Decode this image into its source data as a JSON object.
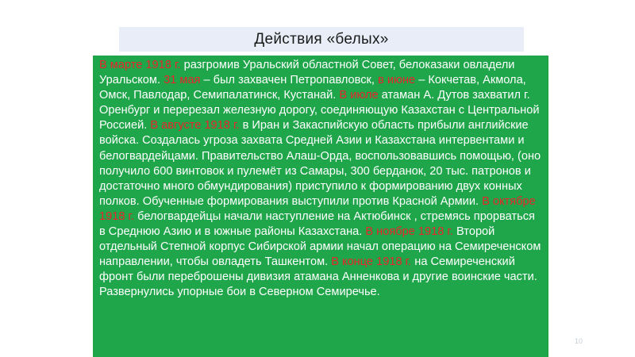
{
  "slide": {
    "title": "Действия «белых»",
    "page_number": "10",
    "colors": {
      "title_bar": "#e8edf7",
      "body_background": "#1fa64a",
      "body_text": "#ffffff",
      "highlight_text": "#e8262b"
    },
    "paragraph": [
      {
        "text": "В марте 1918 г.",
        "highlight": true
      },
      {
        "text": " разгромив Уральский областной Совет, белоказаки овладели Уральском. ",
        "highlight": false
      },
      {
        "text": "31 мая",
        "highlight": true
      },
      {
        "text": " – был захвачен Петропавловск, ",
        "highlight": false
      },
      {
        "text": "в июне",
        "highlight": true
      },
      {
        "text": " – Кокчетав, Акмола, Омск, Павлодар, Семипалатинск, Кустанай.  ",
        "highlight": false
      },
      {
        "text": "В июле",
        "highlight": true
      },
      {
        "text": " атаман А. Дутов захватил г. Оренбург и перерезал железную дорогу, соединяющую Казахстан с Центральной Россией. ",
        "highlight": false
      },
      {
        "text": "В августе 1918 г.",
        "highlight": true
      },
      {
        "text": " в Иран и Закаспийскую область прибыли английские войска. Создалась угроза захвата Средней Азии и Казахстана интервентами и белогвардейцами. Правительство Алаш-Орда, воспользовавшись помощью,    (оно получило 600 винтовок и пулемёт из Самары, 300 берданок, 20 тыс. патронов и достаточно много обмундирования) приступило к формированию двух конных полков. Обученные формирования выступили против Красной Армии. ",
        "highlight": false
      },
      {
        "text": "В октябре 1918 г.",
        "highlight": true
      },
      {
        "text": " белогвардейцы начали наступление на Актюбинск , стремясь прорваться в Среднюю Азию и в южные районы Казахстана. ",
        "highlight": false
      },
      {
        "text": "В ноябре 1918 г.",
        "highlight": true
      },
      {
        "text": " Второй отдельный Степной корпус Сибирской армии начал операцию на Семиреченском направлении, чтобы овладеть Ташкентом.  ",
        "highlight": false
      },
      {
        "text": "В конце 1918 г.",
        "highlight": true
      },
      {
        "text": " на Семиреченский фронт были переброшены дивизия атамана Анненкова и другие воинские части. Развернулись упорные бои в Северном Семиречье.",
        "highlight": false
      }
    ]
  }
}
